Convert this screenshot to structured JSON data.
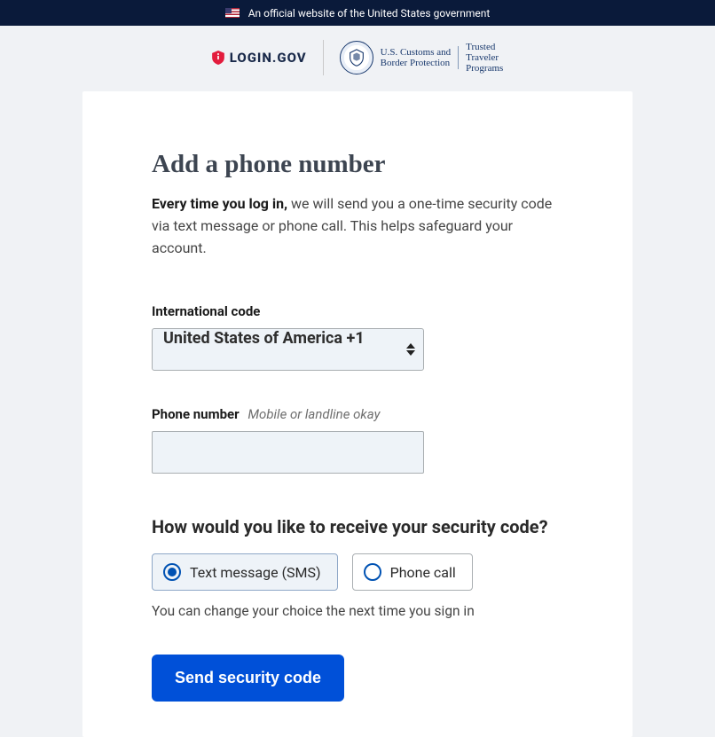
{
  "banner": {
    "text": "An official website of the United States government"
  },
  "logos": {
    "login_gov": "LOGIN.GOV",
    "cbp_line1": "U.S. Customs and",
    "cbp_line2": "Border Protection",
    "ttp_line1": "Trusted",
    "ttp_line2": "Traveler",
    "ttp_line3": "Programs"
  },
  "heading": "Add a phone number",
  "lead_bold": "Every time you log in,",
  "lead_rest": " we will send you a one-time security code via text message or phone call. This helps safeguard your account.",
  "intl_code_label": "International code",
  "intl_code_value": "United States of America +1",
  "phone_label": "Phone number",
  "phone_hint": "Mobile or landline okay",
  "phone_value": "",
  "question": "How would you like to receive your security code?",
  "option_sms": "Text message (SMS)",
  "option_call": "Phone call",
  "change_note": "You can change your choice the next time you sign in",
  "submit_label": "Send security code"
}
